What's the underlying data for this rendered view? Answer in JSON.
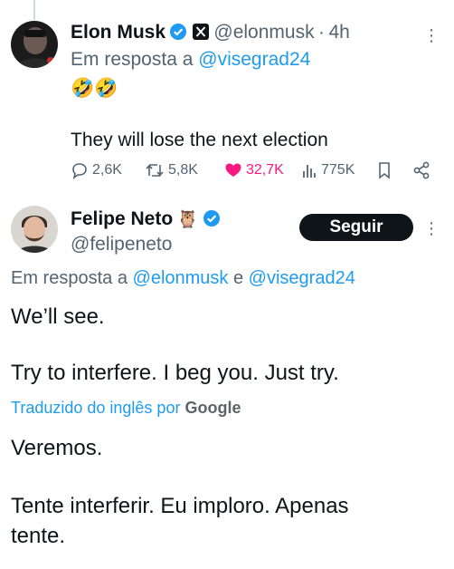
{
  "tweet1": {
    "author_name": "Elon Musk",
    "handle": "@elonmusk",
    "dot": "·",
    "time": "4h",
    "reply_prefix": "Em resposta a",
    "reply_to": "@visegrad24",
    "emoji": "🤣🤣",
    "text": "They will lose the next election",
    "stats": {
      "replies": "2,6K",
      "retweets": "5,8K",
      "likes": "32,7K",
      "views": "775K"
    },
    "colors": {
      "like": "#f91880",
      "verified": "#1d9bf0"
    }
  },
  "tweet2": {
    "author_name": "Felipe Neto",
    "owl": "🦉",
    "handle": "@felipeneto",
    "follow_label": "Seguir",
    "reply_prefix": "Em resposta a",
    "reply_to_1": "@elonmusk",
    "reply_and": "e",
    "reply_to_2": "@visegrad24",
    "text_line1": "We’ll see.",
    "text_line2": "Try to interfere. I beg you. Just try.",
    "translated_by": "Traduzido do inglês por",
    "translator": "Google",
    "translation_line1": "Veremos.",
    "translation_line2a": "Tente interferir. Eu imploro. Apenas",
    "translation_line2b": "tente."
  },
  "icons": [
    "reply-icon",
    "retweet-icon",
    "heart-icon",
    "views-icon",
    "bookmark-icon",
    "share-icon",
    "verified-icon",
    "x-logo-icon",
    "more-icon"
  ]
}
